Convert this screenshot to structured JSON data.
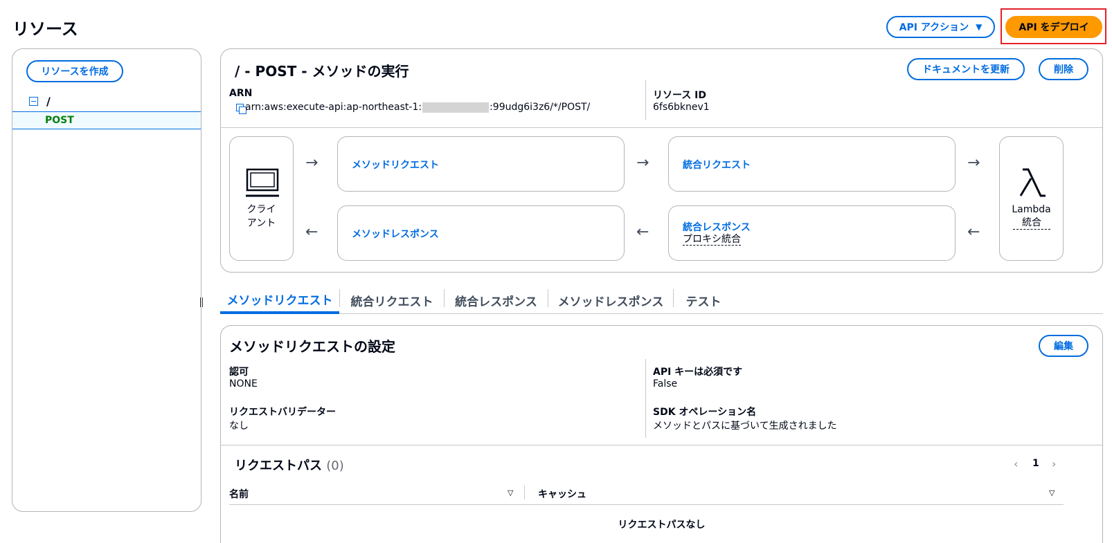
{
  "header": {
    "title": "リソース",
    "api_actions_label": "API アクション",
    "deploy_label": "API をデプロイ"
  },
  "sidebar": {
    "create_resource_label": "リソースを作成",
    "tree_root": "/",
    "tree_selected": "POST"
  },
  "method": {
    "title": "/ - POST - メソッドの実行",
    "update_doc_label": "ドキュメントを更新",
    "delete_label": "削除",
    "arn_label": "ARN",
    "arn_prefix": "arn:aws:execute-api:ap-northeast-1:",
    "arn_suffix": ":99udg6i3z6/*/POST/",
    "resource_id_label": "リソース ID",
    "resource_id_value": "6fs6bknev1"
  },
  "flow": {
    "client_line1": "クライ",
    "client_line2": "アント",
    "method_request": "メソッドリクエスト",
    "integration_request": "統合リクエスト",
    "method_response": "メソッドレスポンス",
    "integration_response": "統合レスポンス",
    "integration_response_sub": "プロキシ統合",
    "lambda_line1": "Lambda",
    "lambda_line2": "統合"
  },
  "tabs": [
    "メソッドリクエスト",
    "統合リクエスト",
    "統合レスポンス",
    "メソッドレスポンス",
    "テスト"
  ],
  "settings": {
    "title": "メソッドリクエストの設定",
    "edit_label": "編集",
    "auth_label": "認可",
    "auth_value": "NONE",
    "api_key_label": "API キーは必須です",
    "api_key_value": "False",
    "validator_label": "リクエストバリデーター",
    "validator_value": "なし",
    "sdk_label": "SDK オペレーション名",
    "sdk_value": "メソッドとパスに基づいて生成されました"
  },
  "request_paths": {
    "title": "リクエストパス",
    "count": "(0)",
    "page": "1",
    "col_name": "名前",
    "col_cache": "キャッシュ",
    "empty": "リクエストパスなし"
  },
  "colors": {
    "primary": "#006ce0",
    "deploy_orange": "#ff9900",
    "highlight_red": "#e3202a",
    "selected_green": "#037f0c"
  }
}
